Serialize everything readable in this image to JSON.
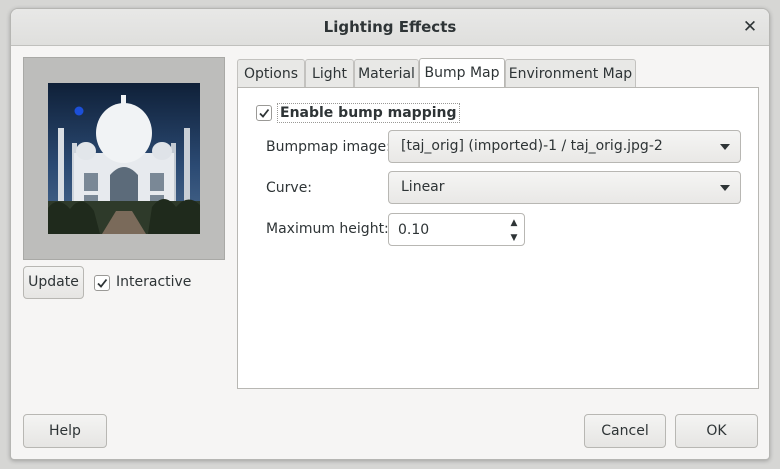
{
  "window": {
    "title": "Lighting Effects",
    "close_glyph": "✕"
  },
  "preview": {
    "update_label": "Update",
    "interactive_label": "Interactive",
    "interactive_checked": true,
    "light_marker_color": "#1c4fd8"
  },
  "tabs": [
    {
      "label": "Options",
      "active": false
    },
    {
      "label": "Light",
      "active": false
    },
    {
      "label": "Material",
      "active": false
    },
    {
      "label": "Bump Map",
      "active": true
    },
    {
      "label": "Environment Map",
      "active": false
    }
  ],
  "bump_map": {
    "enable_label": "Enable bump mapping",
    "enable_checked": true,
    "bumpmap_image_label": "Bumpmap image:",
    "bumpmap_image_value": "[taj_orig] (imported)-1 / taj_orig.jpg-2",
    "curve_label": "Curve:",
    "curve_value": "Linear",
    "max_height_label": "Maximum height:",
    "max_height_value": "0.10"
  },
  "footer": {
    "help_label": "Help",
    "cancel_label": "Cancel",
    "ok_label": "OK"
  },
  "icons": {
    "check": "check-icon",
    "dropdown": "chevron-down-icon",
    "spin_up": "spin-up-icon",
    "spin_down": "spin-down-icon",
    "close": "close-icon"
  }
}
